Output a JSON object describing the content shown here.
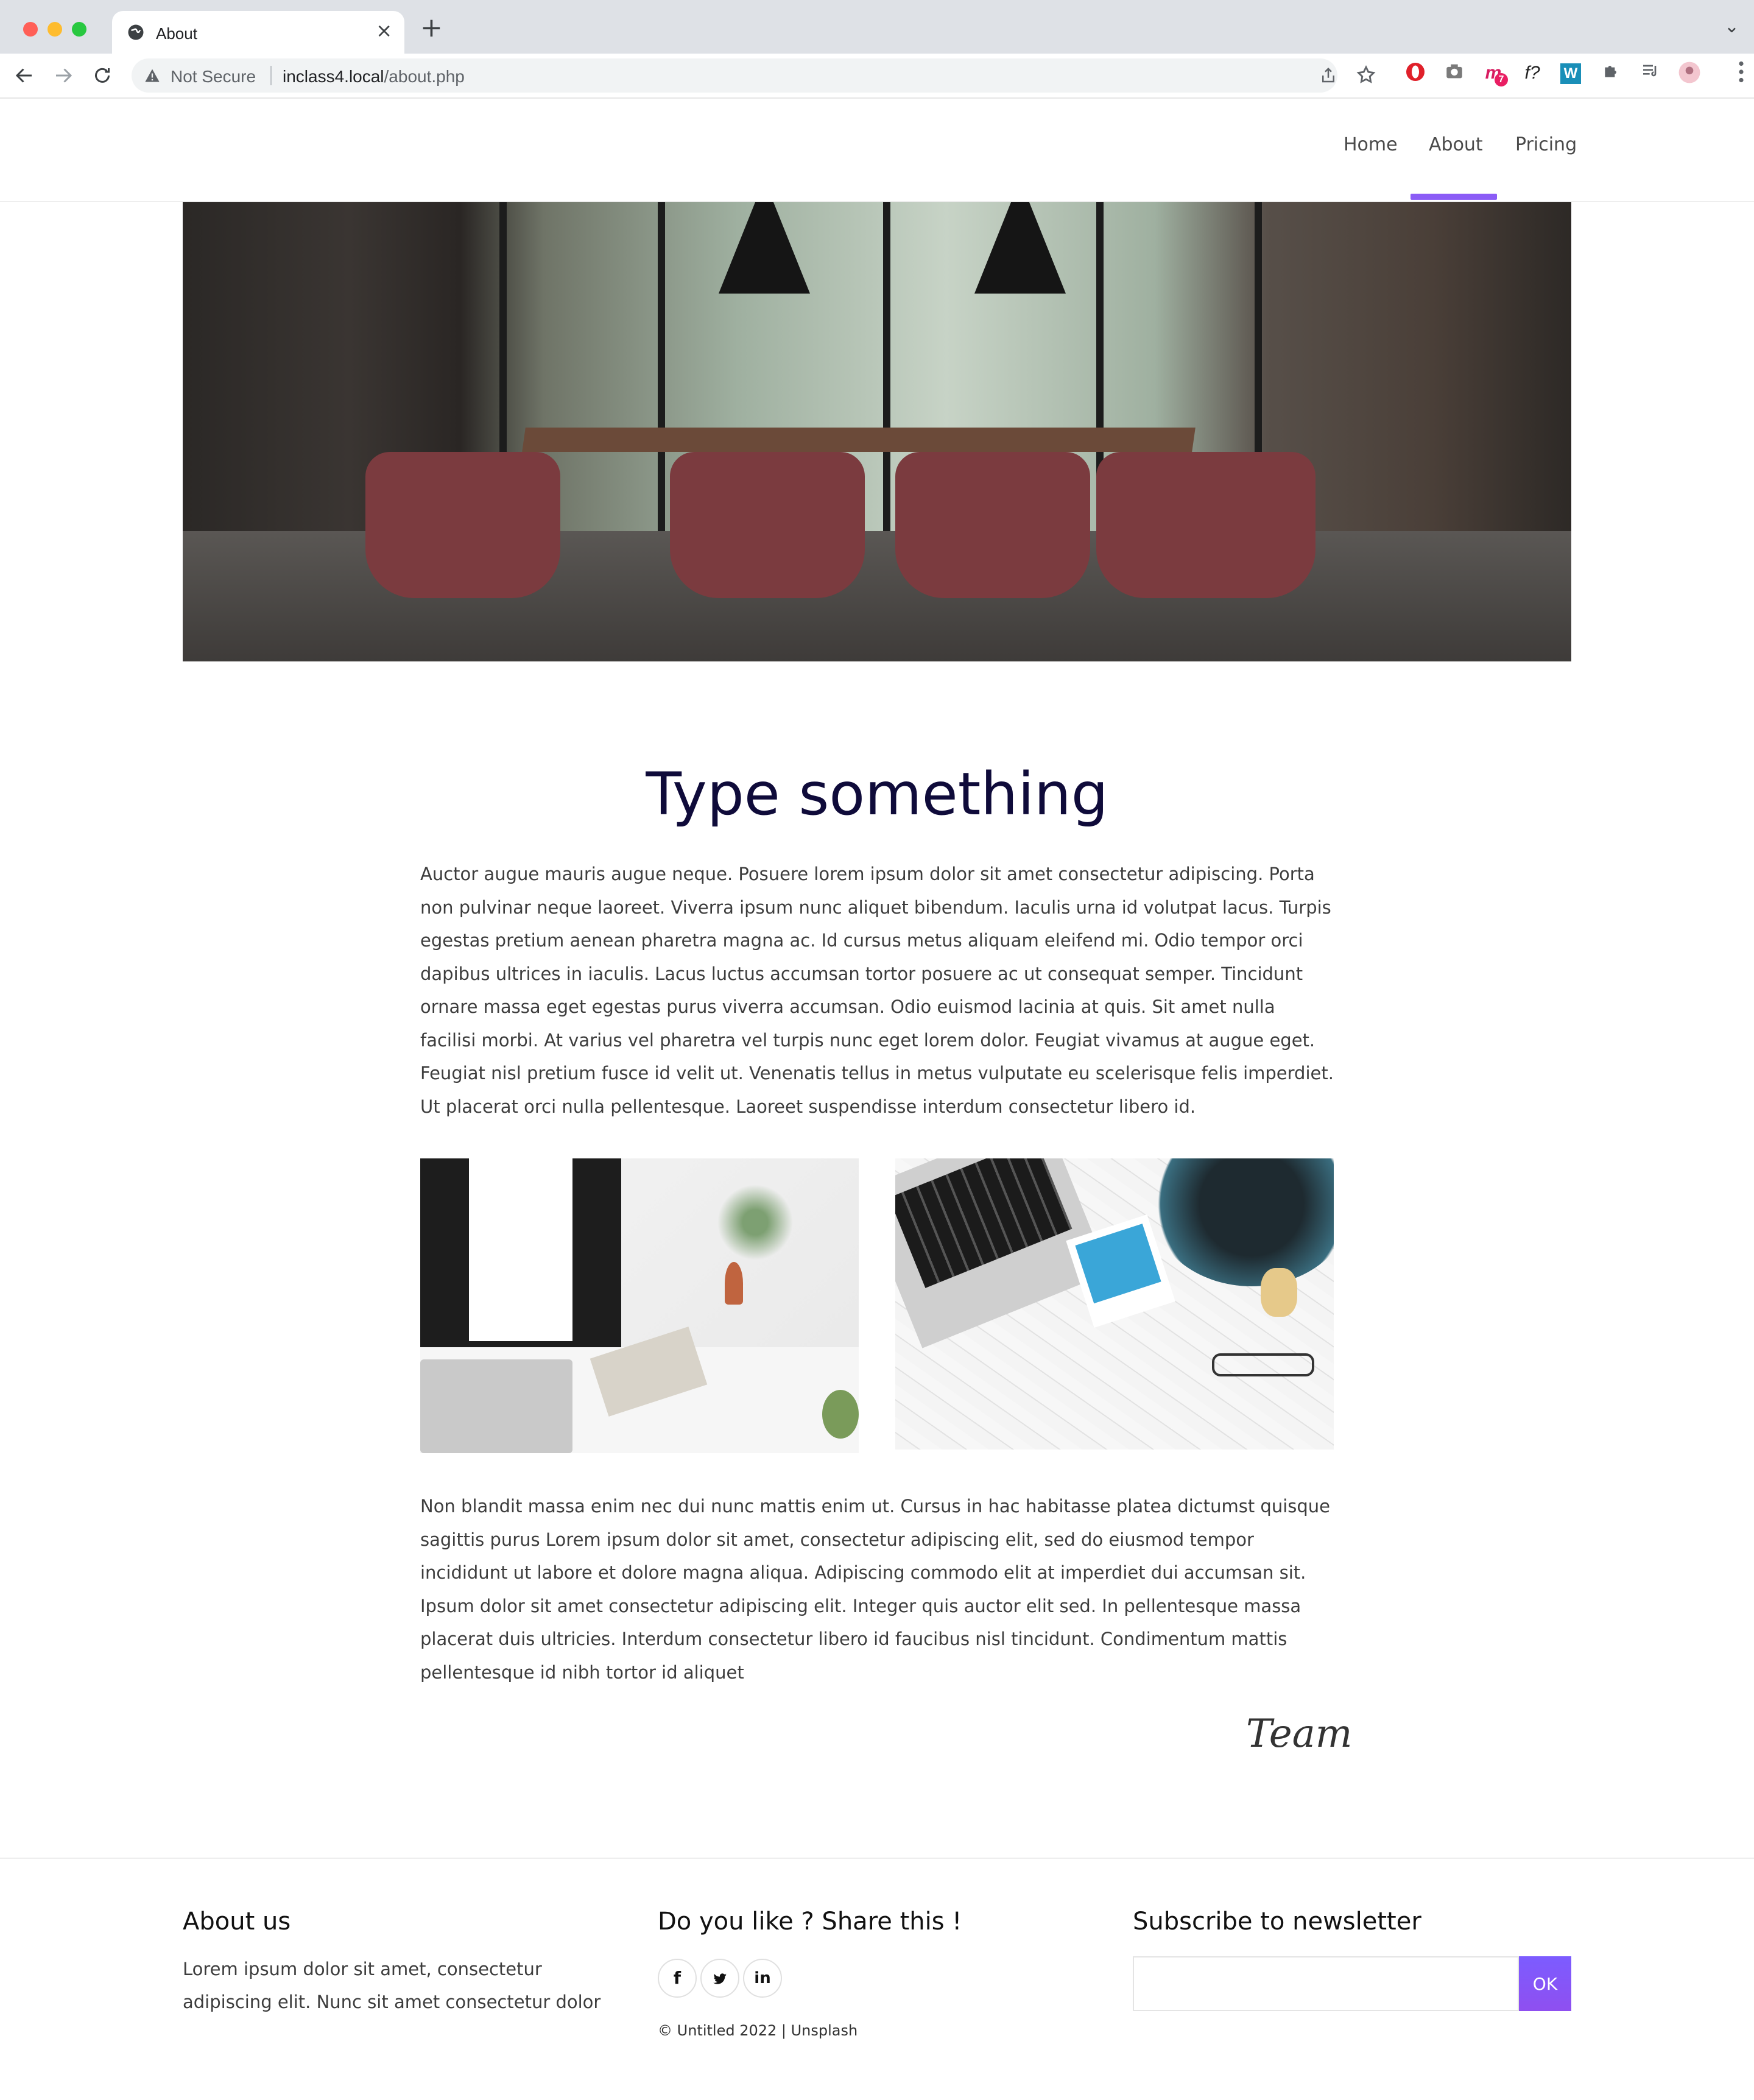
{
  "browser": {
    "tab_title": "About",
    "close_glyph": "×",
    "new_tab_glyph": "+",
    "tab_list_glyph": "⌄",
    "security_label": "Not Secure",
    "url_host": "inclass4.local",
    "url_path": "/about.php",
    "extension_badge": "7",
    "ext_fx_label": "f?",
    "ext_w_label": "W"
  },
  "nav": {
    "items": [
      {
        "label": "Home",
        "active": false
      },
      {
        "label": "About",
        "active": true
      },
      {
        "label": "Pricing",
        "active": false
      }
    ],
    "accent_color": "#8b5cf6"
  },
  "article": {
    "title": "Type something",
    "paragraph1": "Auctor augue mauris augue neque. Posuere lorem ipsum dolor sit amet consectetur adipiscing. Porta non pulvinar neque laoreet. Viverra ipsum nunc aliquet bibendum. Iaculis urna id volutpat lacus. Turpis egestas pretium aenean pharetra magna ac. Id cursus metus aliquam eleifend mi. Odio tempor orci dapibus ultrices in iaculis. Lacus luctus accumsan tortor posuere ac ut consequat semper. Tincidunt ornare massa eget egestas purus viverra accumsan. Odio euismod lacinia at quis. Sit amet nulla facilisi morbi. At varius vel pharetra vel turpis nunc eget lorem dolor. Feugiat vivamus at augue eget. Feugiat nisl pretium fusce id velit ut. Venenatis tellus in metus vulputate eu scelerisque felis imperdiet. Ut placerat orci nulla pellentesque. Laoreet suspendisse interdum consectetur libero id.",
    "paragraph2": "Non blandit massa enim nec dui nunc mattis enim ut. Cursus in hac habitasse platea dictumst quisque sagittis purus Lorem ipsum dolor sit amet, consectetur adipiscing elit, sed do eiusmod tempor incididunt ut labore et dolore magna aliqua. Adipiscing commodo elit at imperdiet dui accumsan sit. Ipsum dolor sit amet consectetur adipiscing elit. Integer quis auctor elit sed. In pellentesque massa placerat duis ultricies. Interdum consectetur libero id faucibus nisl tincidunt. Condimentum mattis pellentesque id nibh tortor id aliquet",
    "signature": "Team"
  },
  "footer": {
    "about_heading": "About us",
    "about_text": "Lorem ipsum dolor sit amet, consectetur adipiscing elit. Nunc sit amet consectetur dolor",
    "share_heading": "Do you like ? Share this !",
    "social": [
      "f",
      "t",
      "in"
    ],
    "copyright": "© Untitled 2022 | Unsplash",
    "newsletter_heading": "Subscribe to newsletter",
    "newsletter_button": "OK",
    "button_color": "#7c5cff"
  }
}
